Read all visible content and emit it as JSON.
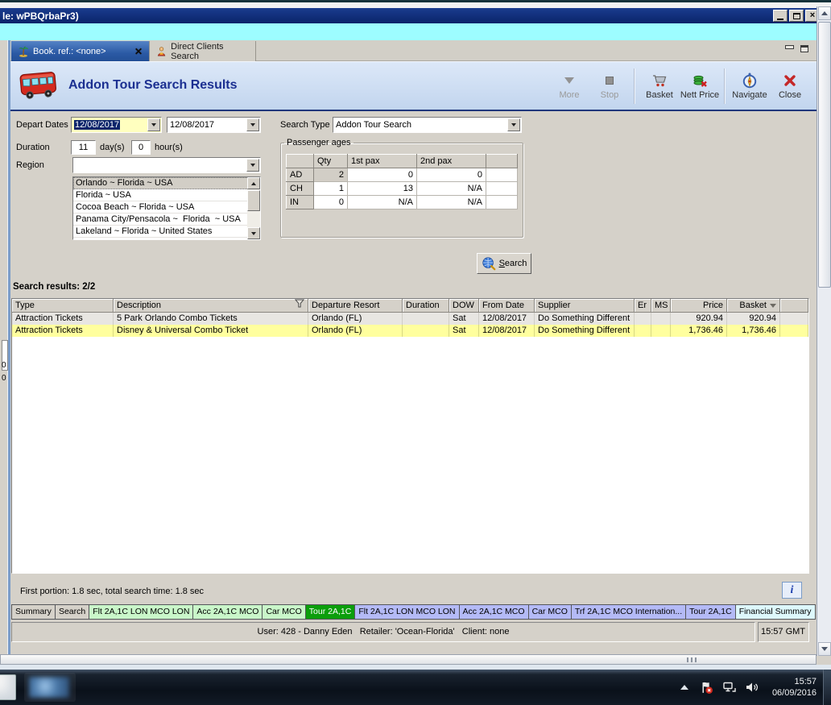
{
  "window": {
    "title": "le: wPBQrbaPr3)"
  },
  "background_fragments": [
    "0",
    "0"
  ],
  "doc_tabs": {
    "tab1": "Book. ref.: <none>",
    "tab2": "Direct Clients Search"
  },
  "header": {
    "title": "Addon Tour Search Results",
    "toolbar": {
      "more": "More",
      "stop": "Stop",
      "basket": "Basket",
      "nett_price": "Nett Price",
      "navigate": "Navigate",
      "close": "Close"
    }
  },
  "form": {
    "depart_dates_label": "Depart Dates",
    "depart_date_1": "12/08/2017",
    "depart_date_2": "12/08/2017",
    "search_type_label": "Search Type",
    "search_type_value": "Addon Tour Search",
    "duration_label": "Duration",
    "duration_days": "11",
    "days_suffix": "day(s)",
    "duration_hours": "0",
    "hours_suffix": "hour(s)",
    "region_label": "Region",
    "region_value": "",
    "region_options": [
      "Orlando ~ Florida ~ USA",
      "Florida ~ USA",
      "Cocoa Beach ~ Florida ~ USA",
      "Panama City/Pensacola ~  Florida  ~ USA",
      "Lakeland ~ Florida ~ United States"
    ],
    "passenger_ages": {
      "legend": "Passenger ages",
      "columns": {
        "qty": "Qty",
        "pax1": "1st pax",
        "pax2": "2nd pax"
      },
      "rows": [
        {
          "code": "AD",
          "qty": "2",
          "pax1": "0",
          "pax2": "0"
        },
        {
          "code": "CH",
          "qty": "1",
          "pax1": "13",
          "pax2": "N/A"
        },
        {
          "code": "IN",
          "qty": "0",
          "pax1": "N/A",
          "pax2": "N/A"
        }
      ]
    },
    "search_button": "Search"
  },
  "results": {
    "label": "Search results: 2/2",
    "columns": {
      "type": "Type",
      "description": "Description",
      "resort": "Departure Resort",
      "duration": "Duration",
      "dow": "DOW",
      "from_date": "From Date",
      "supplier": "Supplier",
      "er": "Er",
      "ms": "MS",
      "price": "Price",
      "basket": "Basket"
    },
    "rows": [
      {
        "type": "Attraction Tickets",
        "description": "5 Park Orlando Combo Tickets",
        "resort": "Orlando (FL)",
        "duration": "",
        "dow": "Sat",
        "from_date": "12/08/2017",
        "supplier": "Do Something Different",
        "er": "",
        "ms": "",
        "price": "920.94",
        "basket": "920.94"
      },
      {
        "type": "Attraction Tickets",
        "description": "Disney & Universal Combo Ticket",
        "resort": "Orlando (FL)",
        "duration": "",
        "dow": "Sat",
        "from_date": "12/08/2017",
        "supplier": "Do Something Different",
        "er": "",
        "ms": "",
        "price": "1,736.46",
        "basket": "1,736.46"
      }
    ],
    "timing": "First portion: 1.8 sec, total search time: 1.8 sec",
    "info_button": "i"
  },
  "bottom_tabs": [
    {
      "label": "Summary"
    },
    {
      "label": "Search"
    },
    {
      "label": "Flt 2A,1C LON MCO LON"
    },
    {
      "label": "Acc 2A,1C MCO"
    },
    {
      "label": "Car MCO"
    },
    {
      "label": "Tour 2A,1C"
    },
    {
      "label": "Flt 2A,1C LON MCO LON"
    },
    {
      "label": "Acc 2A,1C MCO"
    },
    {
      "label": "Car MCO"
    },
    {
      "label": "Trf 2A,1C MCO Internation..."
    },
    {
      "label": "Tour 2A,1C"
    },
    {
      "label": "Financial Summary"
    }
  ],
  "statusbar": {
    "user_info": "User: 428 - Danny Eden   Retailer: 'Ocean-Florida'   Client: none",
    "time": "15:57 GMT"
  },
  "taskbar": {
    "time": "15:57",
    "date": "06/09/2016"
  },
  "colors": {
    "titlebar_navy": "#0a246a",
    "cyan_banner": "#9dfdff",
    "header_blue": "#c2d5ee",
    "title_text": "#1b2f91",
    "highlight_row": "#ffff9e",
    "selected_tab_green": "#0b9e0b",
    "tab_periwinkle": "#b4baf6"
  }
}
